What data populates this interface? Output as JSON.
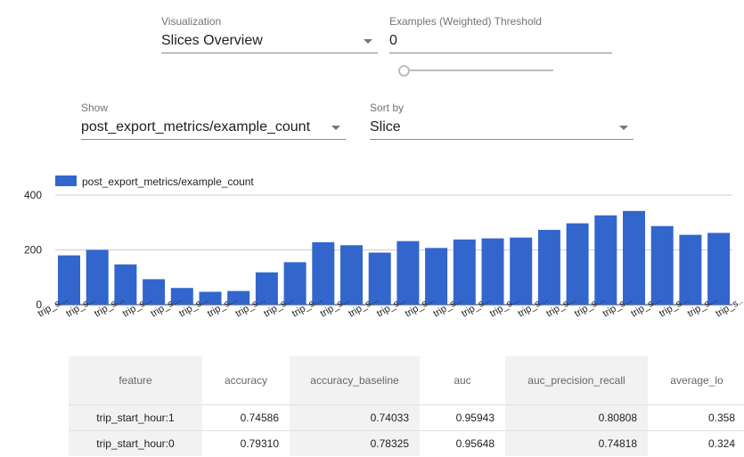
{
  "controls": {
    "visualization": {
      "label": "Visualization",
      "value": "Slices Overview"
    },
    "threshold": {
      "label": "Examples (Weighted) Threshold",
      "value": "0",
      "slider_value": 0
    },
    "show": {
      "label": "Show",
      "value": "post_export_metrics/example_count"
    },
    "sort_by": {
      "label": "Sort by",
      "value": "Slice"
    }
  },
  "colors": {
    "bar": "#3366cc",
    "grid": "#cccccc",
    "axis": "#333333"
  },
  "chart_data": {
    "type": "bar",
    "legend": "post_export_metrics/example_count",
    "categories": [
      "trip_s...",
      "trip_s...",
      "trip_s...",
      "trip_s...",
      "trip_s...",
      "trip_s...",
      "trip_s...",
      "trip_s...",
      "trip_s...",
      "trip_s...",
      "trip_s...",
      "trip_s...",
      "trip_s...",
      "trip_s...",
      "trip_s...",
      "trip_s...",
      "trip_s...",
      "trip_s...",
      "trip_s...",
      "trip_s...",
      "trip_s...",
      "trip_s...",
      "trip_s...",
      "trip_s...",
      "trip_s..."
    ],
    "values": [
      180,
      200,
      147,
      93,
      61,
      47,
      50,
      118,
      155,
      228,
      217,
      190,
      232,
      207,
      238,
      242,
      245,
      273,
      297,
      326,
      342,
      287,
      255,
      262
    ],
    "yticks": [
      0,
      200,
      400
    ],
    "ylim": [
      0,
      400
    ],
    "grid": true
  },
  "table": {
    "columns": [
      "feature",
      "accuracy",
      "accuracy_baseline",
      "auc",
      "auc_precision_recall",
      "average_lo"
    ],
    "rows": [
      [
        "trip_start_hour:1",
        "0.74586",
        "0.74033",
        "0.95943",
        "0.80808",
        "0.358"
      ],
      [
        "trip_start_hour:0",
        "0.79310",
        "0.78325",
        "0.95648",
        "0.74818",
        "0.324"
      ]
    ]
  }
}
